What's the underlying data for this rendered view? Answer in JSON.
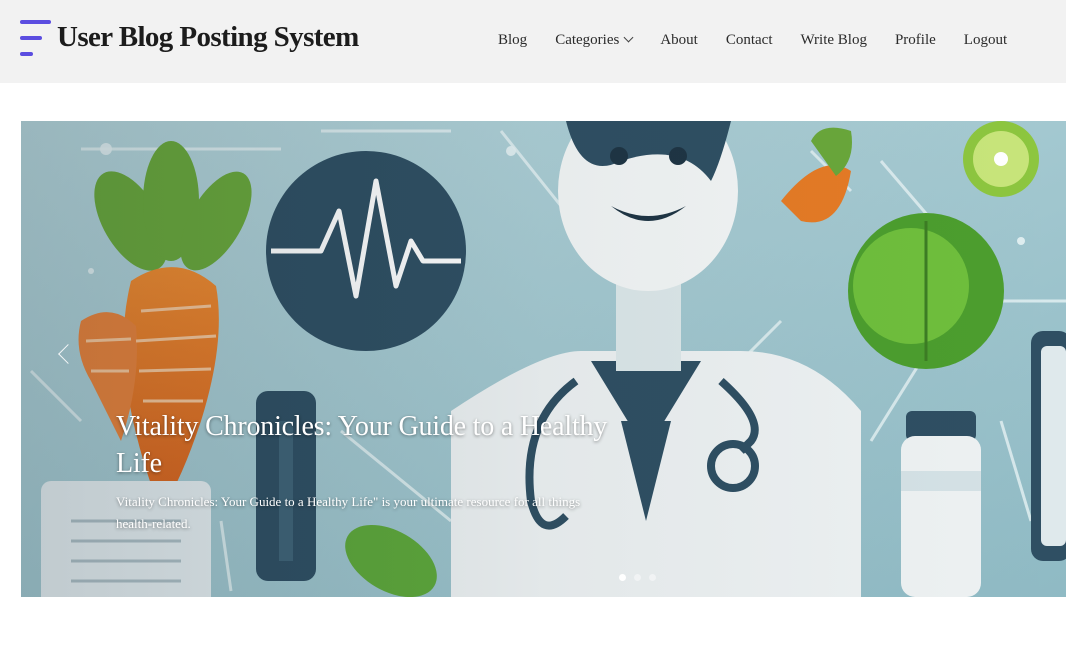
{
  "brand": {
    "title": "User Blog Posting System"
  },
  "nav": {
    "items": [
      {
        "label": "Blog"
      },
      {
        "label": "Categories"
      },
      {
        "label": "About"
      },
      {
        "label": "Contact"
      },
      {
        "label": "Write Blog"
      },
      {
        "label": "Profile"
      },
      {
        "label": "Logout"
      }
    ]
  },
  "hero": {
    "title": "Vitality Chronicles: Your Guide to a Healthy Life",
    "description": "Vitality Chronicles: Your Guide to a Healthy Life\" is your ultimate resource for all things health-related.",
    "slides_count": 3,
    "active_slide": 1
  },
  "icons": {
    "menu": "hamburger-logo-icon",
    "dropdown": "chevron-down-icon",
    "prev": "chevron-left-icon"
  },
  "colors": {
    "accent": "#5b4de0",
    "header_bg": "#f2f2f2",
    "hero_bg": "#a9cbd3"
  }
}
